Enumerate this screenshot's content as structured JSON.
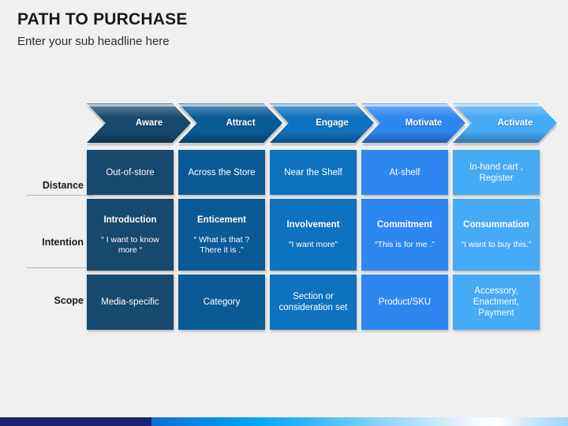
{
  "header": {
    "title": "PATH TO PURCHASE",
    "subtitle": "Enter your sub headline here"
  },
  "colors": {
    "background": "#f0f0f0",
    "stage_1": "#17486e",
    "stage_2": "#0a5a96",
    "stage_3": "#0f72be",
    "stage_4": "#2e86f0",
    "stage_5": "#46aaf5",
    "bar_navy": "#15256e",
    "text_dark": "#1a1a1a",
    "divider": "#b9b9b9"
  },
  "stages": [
    {
      "label": "Aware",
      "color": "#17486e"
    },
    {
      "label": "Attract",
      "color": "#0a5a96"
    },
    {
      "label": "Engage",
      "color": "#0f72be"
    },
    {
      "label": "Motivate",
      "color": "#2e86f0"
    },
    {
      "label": "Activate",
      "color": "#46aaf5"
    }
  ],
  "row_labels": [
    {
      "label": "Distance"
    },
    {
      "label": "Intention"
    },
    {
      "label": "Scope"
    }
  ],
  "rows": {
    "distance": [
      {
        "text": "Out-of-store"
      },
      {
        "text": "Across the Store"
      },
      {
        "text": "Near the Shelf"
      },
      {
        "text": "At-shelf"
      },
      {
        "text": "In-hand cart , Register"
      }
    ],
    "intention": [
      {
        "title": "Introduction",
        "quote": "“ I want to know more “"
      },
      {
        "title": "Enticement",
        "quote": "“ What is that ? There it is .”"
      },
      {
        "title": "Involvement",
        "quote": "“I want more”"
      },
      {
        "title": "Commitment",
        "quote": "“This is for me .”"
      },
      {
        "title": "Consummation",
        "quote": "“I want to buy this.”"
      }
    ],
    "scope": [
      {
        "text": "Media-specific"
      },
      {
        "text": "Category"
      },
      {
        "text": "Section or consideration set"
      },
      {
        "text": "Product/SKU"
      },
      {
        "text": "Accessory, Enactment, Payment"
      }
    ]
  }
}
